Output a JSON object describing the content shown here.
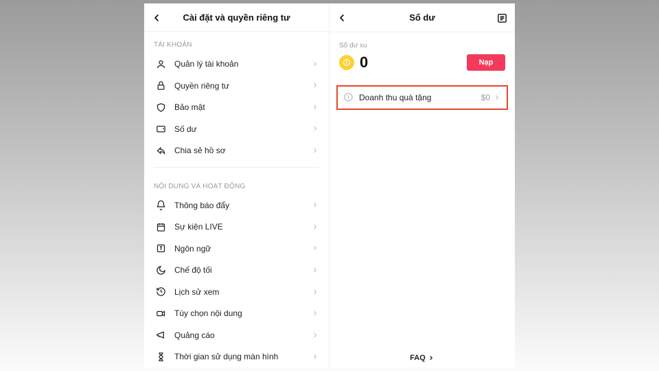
{
  "left": {
    "title": "Cài đặt và quyền riêng tư",
    "section1": "TÀI KHOẢN",
    "items1": [
      {
        "label": "Quản lý tài khoản"
      },
      {
        "label": "Quyền riêng tư"
      },
      {
        "label": "Bảo mật"
      },
      {
        "label": "Số dư"
      },
      {
        "label": "Chia sẻ hồ sơ"
      }
    ],
    "section2": "NỘI DUNG VÀ HOẠT ĐỘNG",
    "items2": [
      {
        "label": "Thông báo đẩy"
      },
      {
        "label": "Sự kiện LIVE"
      },
      {
        "label": "Ngôn ngữ"
      },
      {
        "label": "Chế độ tối"
      },
      {
        "label": "Lịch sử xem"
      },
      {
        "label": "Tùy chọn nội dung"
      },
      {
        "label": "Quảng cáo"
      },
      {
        "label": "Thời gian sử dụng màn hình"
      }
    ]
  },
  "right": {
    "title": "Số dư",
    "sub": "Số dư xu",
    "balance": "0",
    "topup": "Nạp",
    "revenue_label": "Doanh thu quà tặng",
    "revenue_value": "$0",
    "faq": "FAQ"
  },
  "colors": {
    "accent": "#f33a5a",
    "highlight_border": "#e7482b",
    "coin": "#ffcf2f"
  }
}
